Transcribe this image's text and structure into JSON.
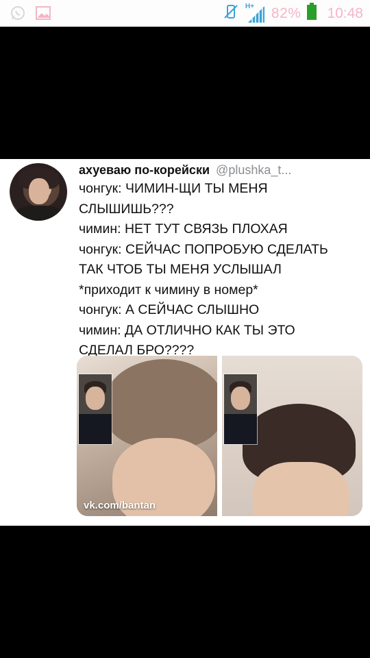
{
  "status_bar": {
    "icons_left": [
      "whatsapp-icon",
      "gallery-icon"
    ],
    "network_type": "H+",
    "battery_percent": "82%",
    "time": "10:48",
    "accent_color": "#f4b5c6"
  },
  "tweet": {
    "author_name": "ахуеваю по-корейски",
    "handle": "@plushka_t...",
    "lines": [
      "чонгук: ЧИМИН-ЩИ ТЫ МЕНЯ",
      "СЛЫШИШЬ???",
      "чимин: НЕТ ТУТ СВЯЗЬ ПЛОХАЯ",
      "чонгук: СЕЙЧАС ПОПРОБУЮ СДЕЛАТЬ",
      "ТАК ЧТОБ ТЫ МЕНЯ УСЛЫШАЛ",
      "*приходит к чимину в номер*",
      "чонгук: А СЕЙЧАС СЛЫШНО",
      "чимин: ДА ОТЛИЧНО КАК ТЫ ЭТО",
      "СДЕЛАЛ БРО????"
    ],
    "watermark": "vk.com/bantan"
  }
}
